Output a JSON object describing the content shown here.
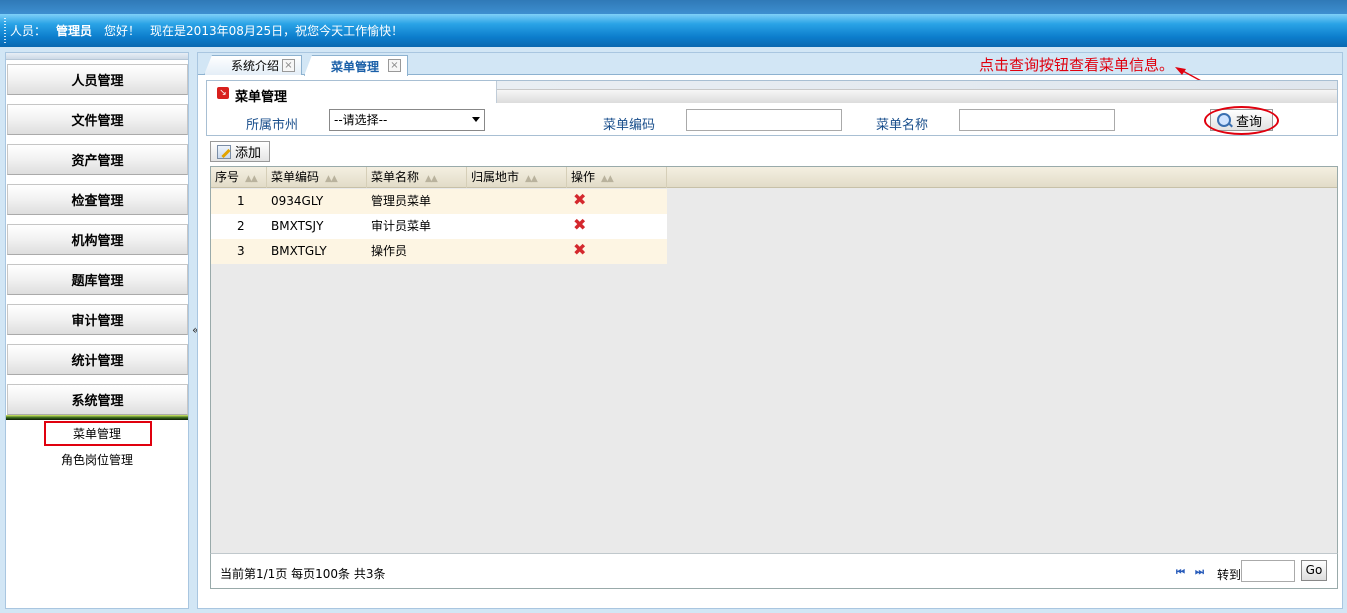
{
  "topbar": {
    "label": "人员：",
    "user": "管理员",
    "greeting": "您好！",
    "message": "现在是2013年08月25日，祝您今天工作愉快！"
  },
  "sidebar": {
    "menus": [
      "人员管理",
      "文件管理",
      "资产管理",
      "检查管理",
      "机构管理",
      "题库管理",
      "审计管理",
      "统计管理",
      "系统管理"
    ],
    "submenu": [
      "菜单管理",
      "角色岗位管理"
    ],
    "collapse": "«"
  },
  "tabs": [
    {
      "label": "系统介绍",
      "close": "×"
    },
    {
      "label": "菜单管理",
      "close": "×"
    }
  ],
  "annotation": "点击查询按钮查看菜单信息。",
  "panel": {
    "title": "菜单管理",
    "icon": "↘",
    "filters": {
      "city_label": "所属市州",
      "city_value": "--请选择--",
      "code_label": "菜单编码",
      "code_value": "",
      "name_label": "菜单名称",
      "name_value": ""
    },
    "query_button": "查询"
  },
  "add_button": "添加",
  "table": {
    "columns": [
      "序号",
      "菜单编码",
      "菜单名称",
      "归属地市",
      "操作"
    ],
    "sort_glyph": "▲▲",
    "rows": [
      {
        "no": "1",
        "code": "0934GLY",
        "name": "管理员菜单",
        "city": "",
        "delete": "✖"
      },
      {
        "no": "2",
        "code": "BMXTSJY",
        "name": "审计员菜单",
        "city": "",
        "delete": "✖"
      },
      {
        "no": "3",
        "code": "BMXTGLY",
        "name": "操作员",
        "city": "",
        "delete": "✖"
      }
    ]
  },
  "pagination": {
    "info": "当前第1/1页  每页100条  共3条",
    "first": "⏮",
    "last": "⏭",
    "jump_label": "转到",
    "jump_value": "",
    "go": "Go"
  },
  "colors": {
    "accent": "#0c7dcc",
    "highlight": "#e0000e",
    "delete": "#d4282d"
  }
}
